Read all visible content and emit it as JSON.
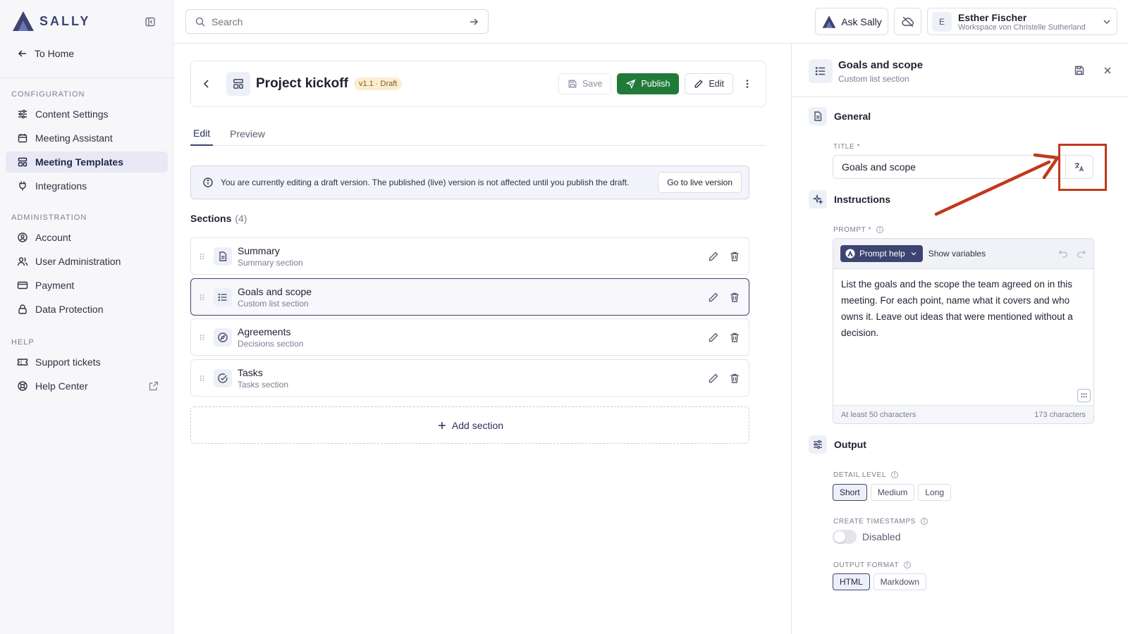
{
  "app": {
    "logo_text": "SALLY"
  },
  "sidebar": {
    "home_label": "To Home",
    "sections": [
      {
        "title": "CONFIGURATION",
        "items": [
          {
            "label": "Content Settings",
            "icon": "sliders-icon"
          },
          {
            "label": "Meeting Assistant",
            "icon": "calendar-icon"
          },
          {
            "label": "Meeting Templates",
            "icon": "template-icon",
            "active": true
          },
          {
            "label": "Integrations",
            "icon": "plug-icon"
          }
        ]
      },
      {
        "title": "ADMINISTRATION",
        "items": [
          {
            "label": "Account",
            "icon": "user-circle-icon"
          },
          {
            "label": "User Administration",
            "icon": "users-icon"
          },
          {
            "label": "Payment",
            "icon": "credit-card-icon"
          },
          {
            "label": "Data Protection",
            "icon": "lock-icon"
          }
        ]
      },
      {
        "title": "HELP",
        "items": [
          {
            "label": "Support tickets",
            "icon": "ticket-icon"
          },
          {
            "label": "Help Center",
            "icon": "lifebuoy-icon",
            "external": true
          }
        ]
      }
    ]
  },
  "topbar": {
    "search_placeholder": "Search",
    "ask_label": "Ask Sally",
    "user": {
      "initial": "E",
      "name": "Esther Fischer",
      "workspace": "Workspace von Christelle Sutherland"
    }
  },
  "template": {
    "title": "Project kickoff",
    "version_badge": "v1.1 · Draft",
    "save_label": "Save",
    "publish_label": "Publish",
    "edit_label": "Edit"
  },
  "tabs": [
    {
      "label": "Edit",
      "active": true
    },
    {
      "label": "Preview"
    }
  ],
  "banner": {
    "text": "You are currently editing a draft version. The published (live) version is not affected until you publish the draft.",
    "button": "Go to live version"
  },
  "sections": {
    "title": "Sections",
    "count": "(4)",
    "items": [
      {
        "name": "Summary",
        "type": "Summary section",
        "icon": "document-icon"
      },
      {
        "name": "Goals and scope",
        "type": "Custom list section",
        "icon": "list-icon",
        "selected": true
      },
      {
        "name": "Agreements",
        "type": "Decisions section",
        "icon": "compass-icon"
      },
      {
        "name": "Tasks",
        "type": "Tasks section",
        "icon": "check-circle-icon"
      }
    ],
    "add_label": "Add section"
  },
  "panel": {
    "title": "Goals and scope",
    "subtitle": "Custom list section",
    "general_label": "General",
    "title_field_label": "TITLE *",
    "title_value": "Goals and scope",
    "instructions_label": "Instructions",
    "prompt_label": "PROMPT *",
    "prompt_help_label": "Prompt help",
    "show_variables_label": "Show variables",
    "prompt_text": "List the goals and the scope the team agreed on in this meeting. For each point, name what it covers and who owns it. Leave out ideas that were mentioned without a decision.",
    "min_chars_label": "At least 50 characters",
    "char_count": "173 characters",
    "output_label": "Output",
    "detail_level_label": "DETAIL LEVEL",
    "detail_levels": [
      "Short",
      "Medium",
      "Long"
    ],
    "detail_selected": "Short",
    "timestamps_label": "CREATE TIMESTAMPS",
    "timestamps_state": "Disabled",
    "format_label": "OUTPUT FORMAT",
    "formats": [
      "HTML",
      "Markdown"
    ],
    "format_selected": "HTML"
  },
  "colors": {
    "accent": "#3d4470",
    "publish": "#217a3a",
    "highlight": "#c0391b",
    "badge_bg": "#fbedd2"
  }
}
